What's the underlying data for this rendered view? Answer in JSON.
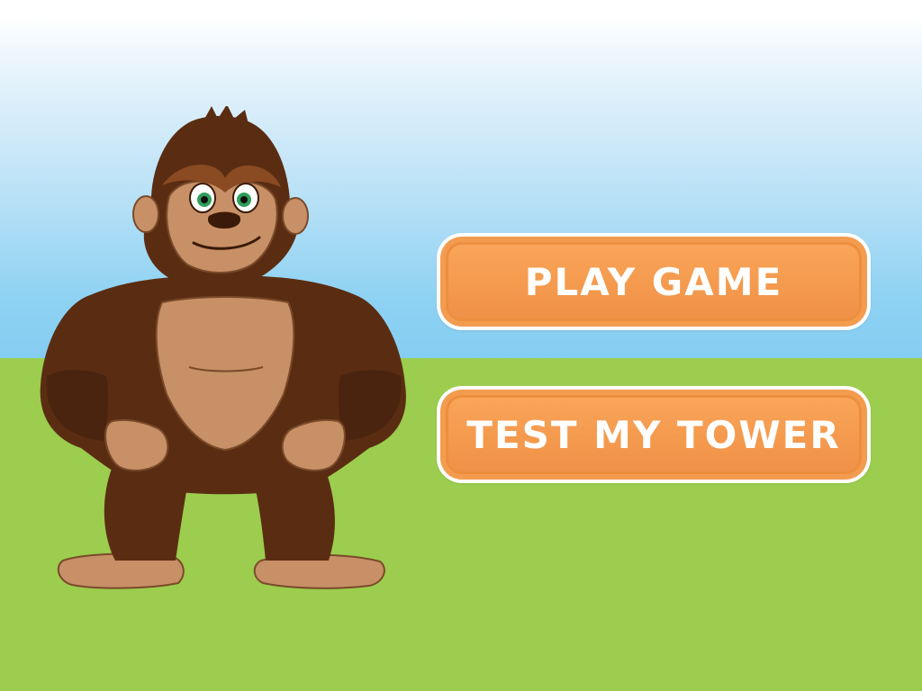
{
  "scene": {
    "sky_color": "#84cdf2",
    "ground_color": "#9ccd4e"
  },
  "character": {
    "name_icon": "gorilla-mascot",
    "fur_color": "#5a2d12",
    "skin_color": "#c89066",
    "eye_color": "#2e9e5a"
  },
  "menu": {
    "play_label": "PLAY GAME",
    "test_label": "TEST MY TOWER",
    "button_color": "#f49a4e"
  }
}
